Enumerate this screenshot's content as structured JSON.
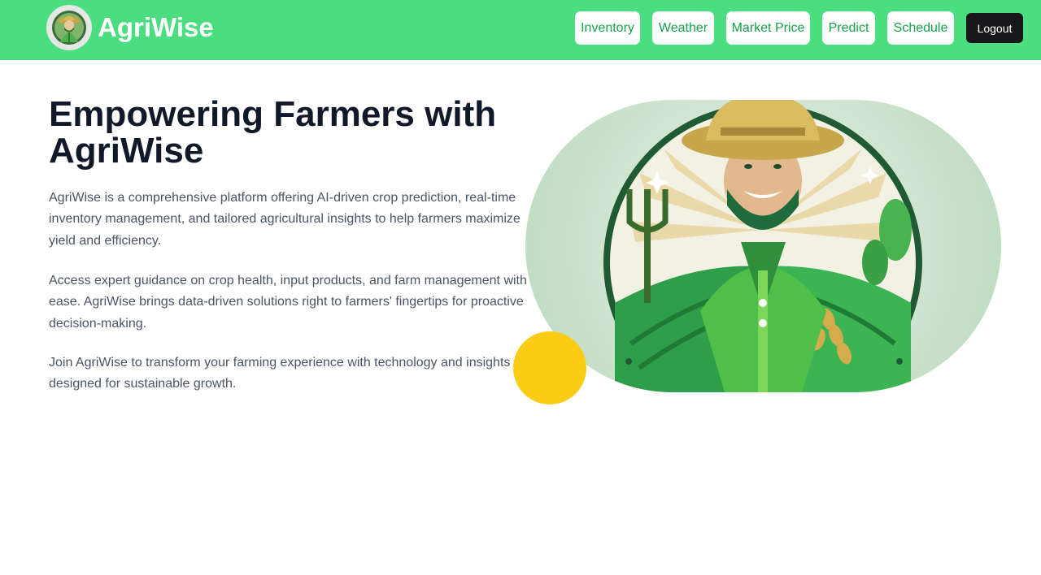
{
  "brand": {
    "name": "AgriWise",
    "logo_icon": "farmer-logo-icon"
  },
  "nav": {
    "items": [
      {
        "label": "Inventory"
      },
      {
        "label": "Weather"
      },
      {
        "label": "Market Price"
      },
      {
        "label": "Predict"
      },
      {
        "label": "Schedule"
      }
    ],
    "logout_label": "Logout"
  },
  "hero": {
    "title": "Empowering Farmers with AgriWise",
    "paragraphs": [
      "AgriWise is a comprehensive platform offering AI-driven crop prediction, real-time inventory management, and tailored agricultural insights to help farmers maximize yield and efficiency.",
      "Access expert guidance on crop health, input products, and farm management with ease. AgriWise brings data-driven solutions right to farmers' fingertips for proactive decision-making.",
      "Join AgriWise to transform your farming experience with technology and insights designed for sustainable growth."
    ],
    "illustration_icon": "farmer-illustration-icon"
  },
  "colors": {
    "navbar": "#4ade80",
    "nav_text": "#16a34a",
    "logout_bg": "#18181b",
    "title": "#111827",
    "body_text": "#4b5563",
    "accent_yellow": "#facc15"
  }
}
